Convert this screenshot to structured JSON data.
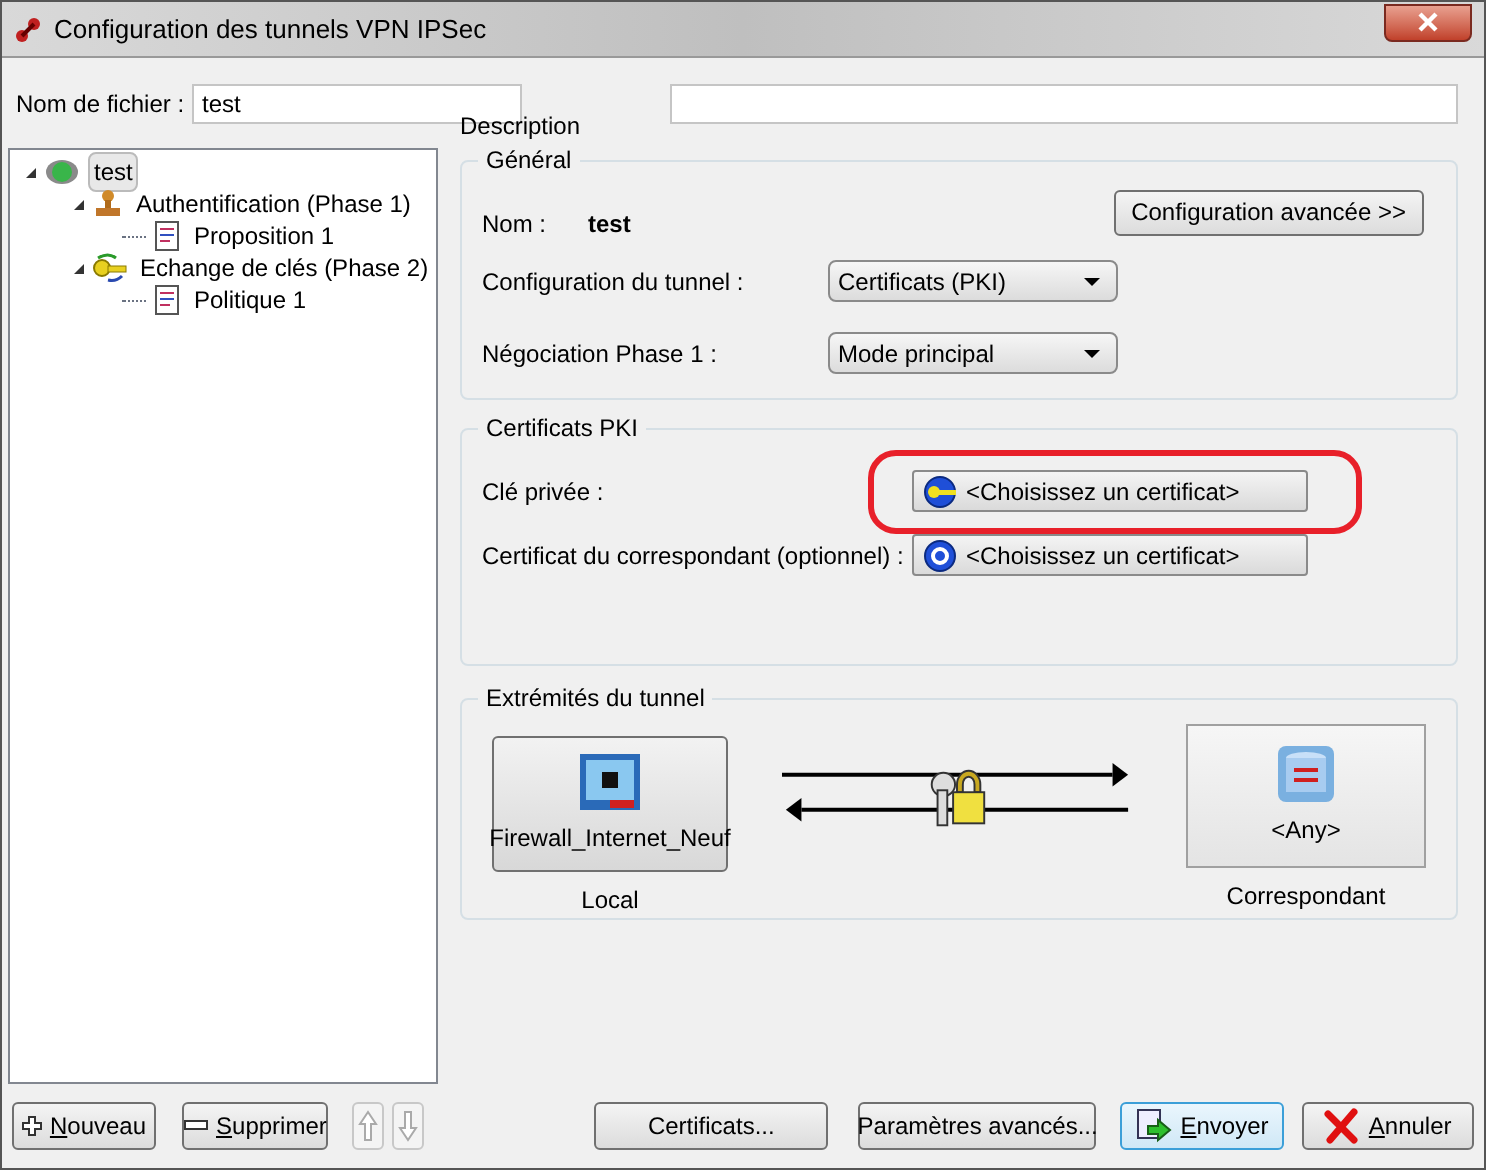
{
  "window": {
    "title": "Configuration des tunnels VPN IPSec"
  },
  "file_name": {
    "label": "Nom de fichier :",
    "value": "test"
  },
  "description": {
    "label": "Description"
  },
  "tree": [
    {
      "label": "test",
      "kind": "network",
      "selected": true,
      "expanded": true,
      "children": [
        {
          "label": "Authentification (Phase 1)",
          "kind": "stamp",
          "selected": false,
          "expanded": true,
          "children": [
            {
              "label": "Proposition 1",
              "kind": "document",
              "selected": false
            }
          ]
        },
        {
          "label": "Echange de clés (Phase 2)",
          "kind": "key",
          "selected": false,
          "expanded": true,
          "children": [
            {
              "label": "Politique 1",
              "kind": "document",
              "selected": false
            }
          ]
        }
      ]
    }
  ],
  "general": {
    "title": "Général",
    "name_label": "Nom :",
    "name_value": "test",
    "advanced_button": "Configuration avancée >>",
    "tunnel_label": "Configuration du tunnel :",
    "tunnel_value": "Certificats (PKI)",
    "phase1_label": "Négociation Phase 1 :",
    "phase1_value": "Mode principal"
  },
  "certificates": {
    "title": "Certificats PKI",
    "rows": [
      {
        "label": "Clé privée :",
        "button": "<Choisissez un certificat>",
        "kind": "key",
        "highlighted": true
      },
      {
        "label": "Certificat du correspondant (optionnel) :",
        "button": "<Choisissez un certificat>",
        "kind": "certificate",
        "highlighted": false
      }
    ]
  },
  "endpoints": {
    "title": "Extrémités du tunnel",
    "local": {
      "name": "Firewall_Internet_Neuf",
      "caption": "Local"
    },
    "remote": {
      "name": "<Any>",
      "caption": "Correspondant"
    }
  },
  "bottom_buttons": [
    {
      "label": "Nouveau",
      "kind": "plus",
      "mnemonic": true,
      "disabled": false,
      "default": false
    },
    {
      "label": "Supprimer",
      "kind": "minus",
      "mnemonic": true,
      "disabled": false,
      "default": false
    },
    {
      "kind": "up",
      "disabled": true
    },
    {
      "kind": "down",
      "disabled": true
    },
    {
      "label": "Certificats...",
      "kind": "text",
      "mnemonic": false,
      "disabled": false,
      "default": false
    },
    {
      "label": "Paramètres avancés...",
      "kind": "text",
      "mnemonic": false,
      "disabled": false,
      "default": false
    },
    {
      "label": "Envoyer",
      "kind": "send",
      "mnemonic": true,
      "disabled": false,
      "default": true
    },
    {
      "label": "Annuler",
      "kind": "cancel",
      "mnemonic": true,
      "disabled": false,
      "default": false
    }
  ]
}
